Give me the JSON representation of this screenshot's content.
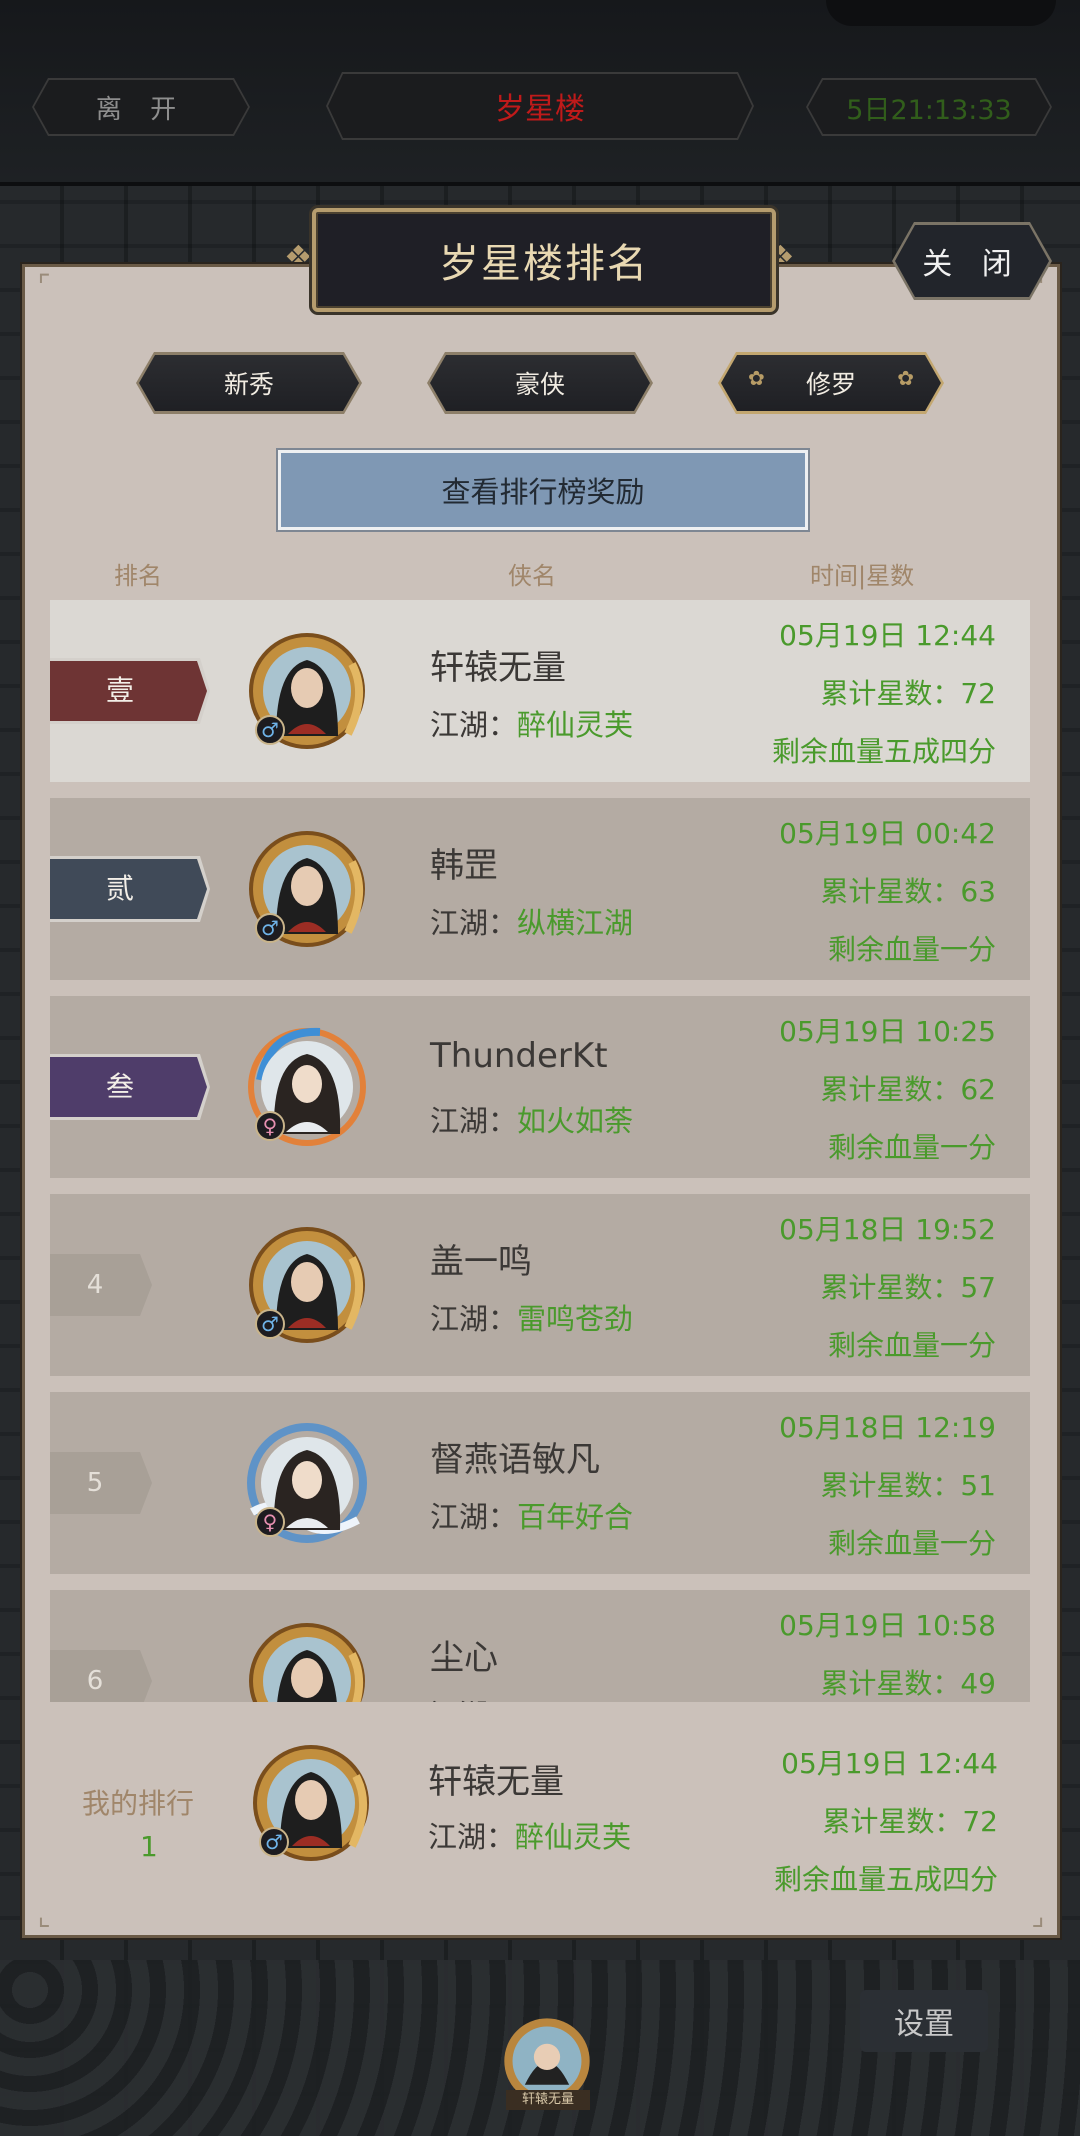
{
  "header": {
    "leave_label": "离 开",
    "title": "岁星楼",
    "countdown": "5日21:13:33"
  },
  "panel": {
    "title": "岁星楼排名",
    "close_label": "关 闭",
    "tabs": [
      {
        "label": "新秀",
        "active": false
      },
      {
        "label": "豪侠",
        "active": false
      },
      {
        "label": "修罗",
        "active": true
      }
    ],
    "reward_button": "查看排行榜奖励",
    "columns": {
      "rank": "排名",
      "name": "侠名",
      "time_stars": "时间|星数"
    },
    "guild_prefix": "江湖：",
    "rows": [
      {
        "rank": "壹",
        "rank_color": "#6e3434",
        "name": "轩辕无量",
        "guild": "醉仙灵芙",
        "time": "05月19日 12:44",
        "stars": "累计星数：72",
        "hp": "剩余血量五成四分",
        "gender": "♂",
        "avatar": "male"
      },
      {
        "rank": "贰",
        "rank_color": "#404a58",
        "name": "韩罡",
        "guild": "纵横江湖",
        "time": "05月19日 00:42",
        "stars": "累计星数：63",
        "hp": "剩余血量一分",
        "gender": "♂",
        "avatar": "male"
      },
      {
        "rank": "叁",
        "rank_color": "#4f3d6a",
        "name": "ThunderKt",
        "guild": "如火如荼",
        "time": "05月19日 10:25",
        "stars": "累计星数：62",
        "hp": "剩余血量一分",
        "gender": "♀",
        "avatar": "female-fire"
      },
      {
        "rank": "4",
        "rank_color": "",
        "name": "盖一鸣",
        "guild": "雷鸣苍劲",
        "time": "05月18日 19:52",
        "stars": "累计星数：57",
        "hp": "剩余血量一分",
        "gender": "♂",
        "avatar": "male"
      },
      {
        "rank": "5",
        "rank_color": "",
        "name": "督燕语敏凡",
        "guild": "百年好合",
        "time": "05月18日 12:19",
        "stars": "累计星数：51",
        "hp": "剩余血量一分",
        "gender": "♀",
        "avatar": "female-wave"
      },
      {
        "rank": "6",
        "rank_color": "",
        "name": "尘心",
        "guild": "",
        "time": "05月19日 10:58",
        "stars": "累计星数：49",
        "hp": "",
        "gender": "♂",
        "avatar": "male"
      }
    ],
    "my_rank": {
      "label": "我的排行",
      "rank": "1",
      "name": "轩辕无量",
      "guild": "醉仙灵芙",
      "time": "05月19日 12:44",
      "stars": "累计星数：72",
      "hp": "剩余血量五成四分",
      "gender": "♂"
    }
  },
  "footer": {
    "settings_label": "设置",
    "player_name": "轩辕无量"
  },
  "colors": {
    "panel_bg": "#cbc1ba",
    "highlight_row": "#dbd8d3",
    "row_bg": "#b4aba3",
    "green_text": "#4a9a2c",
    "reward_button": "#7f98b4"
  }
}
